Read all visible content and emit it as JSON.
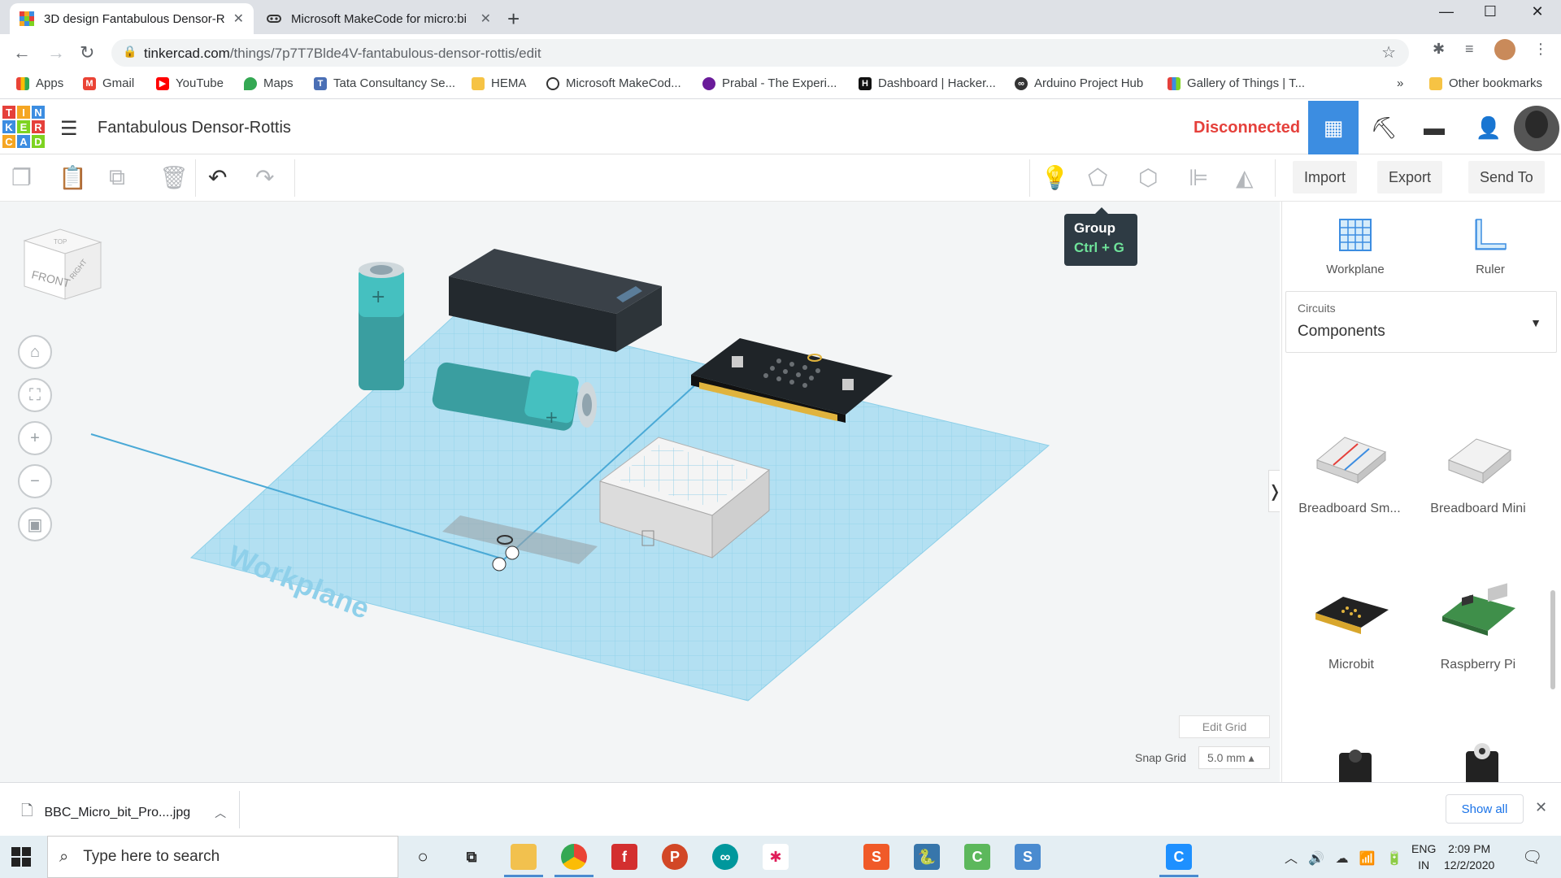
{
  "browser": {
    "tabs": [
      {
        "title": "3D design Fantabulous Densor-R",
        "active": true
      },
      {
        "title": "Microsoft MakeCode for micro:bi",
        "active": false
      }
    ],
    "url_host": "tinkercad.com",
    "url_path": "/things/7p7T7Blde4V-fantabulous-densor-rottis/edit",
    "bookmarks": [
      "Apps",
      "Gmail",
      "YouTube",
      "Maps",
      "Tata Consultancy Se...",
      "HEMA",
      "Microsoft MakeCod...",
      "Prabal - The Experi...",
      "Dashboard | Hacker...",
      "Arduino Project Hub",
      "Gallery of Things | T..."
    ],
    "bookmarks_overflow": "»",
    "other_bookmarks": "Other bookmarks"
  },
  "app": {
    "logo_letters": [
      "T",
      "I",
      "N",
      "K",
      "E",
      "R",
      "C",
      "A",
      "D"
    ],
    "design_title": "Fantabulous Densor-Rottis",
    "status": "Disconnected"
  },
  "toolbar": {
    "import_label": "Import",
    "export_label": "Export",
    "sendto_label": "Send To"
  },
  "tooltip": {
    "title": "Group",
    "shortcut": "Ctrl + G"
  },
  "viewcube": {
    "front": "FRONT",
    "right": "RIGHT",
    "top": "TOP"
  },
  "workplane_text": "Workplane",
  "grid": {
    "edit_grid_label": "Edit Grid",
    "snap_grid_label": "Snap Grid",
    "snap_grid_value": "5.0 mm ▴"
  },
  "panel": {
    "workplane_label": "Workplane",
    "ruler_label": "Ruler",
    "category_group": "Circuits",
    "category_value": "Components",
    "components": [
      "Breadboard Sm...",
      "Breadboard Mini",
      "Microbit",
      "Raspberry Pi"
    ]
  },
  "download": {
    "filename": "BBC_Micro_bit_Pro....jpg",
    "show_all": "Show all"
  },
  "taskbar": {
    "search_placeholder": "Type here to search",
    "lang_1": "ENG",
    "lang_2": "IN",
    "time": "2:09 PM",
    "date": "12/2/2020"
  },
  "colors": {
    "accent": "#3c8de1",
    "status_red": "#e5403b",
    "grid_blue": "#a8dcf0"
  }
}
